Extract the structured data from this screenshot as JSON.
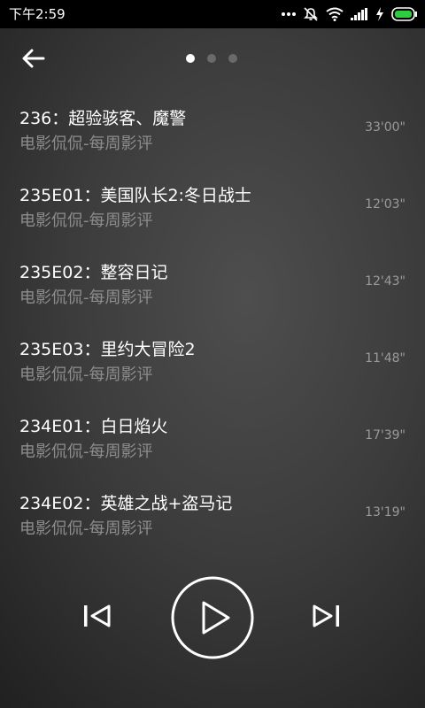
{
  "status_bar": {
    "time": "下午2:59",
    "icons": [
      "more-dots-icon",
      "mute-icon",
      "wifi-icon",
      "signal-icon",
      "charging-icon",
      "battery-icon"
    ]
  },
  "header": {
    "back_icon": "arrow-left-icon",
    "page_count": 3,
    "active_page": 1
  },
  "tracks": [
    {
      "title": "236：超验骇客、魔警",
      "subtitle": "电影侃侃-每周影评",
      "duration": "33'00\""
    },
    {
      "title": "235E01：美国队长2:冬日战士",
      "subtitle": "电影侃侃-每周影评",
      "duration": "12'03\""
    },
    {
      "title": "235E02：整容日记",
      "subtitle": "电影侃侃-每周影评",
      "duration": "12'43\""
    },
    {
      "title": "235E03：里约大冒险2",
      "subtitle": "电影侃侃-每周影评",
      "duration": "11'48\""
    },
    {
      "title": "234E01：白日焰火",
      "subtitle": "电影侃侃-每周影评",
      "duration": "17'39\""
    },
    {
      "title": "234E02：英雄之战+盗马记",
      "subtitle": "电影侃侃-每周影评",
      "duration": "13'19\""
    }
  ],
  "player_controls": {
    "prev_icon": "skip-previous-icon",
    "play_icon": "play-icon",
    "next_icon": "skip-next-icon"
  },
  "colors": {
    "status_bar_bg": "#000000",
    "title_text": "#ffffff",
    "subtitle_text": "#8d8d8d",
    "duration_text": "#9a9a9a",
    "battery_accent": "#2ecc40"
  }
}
